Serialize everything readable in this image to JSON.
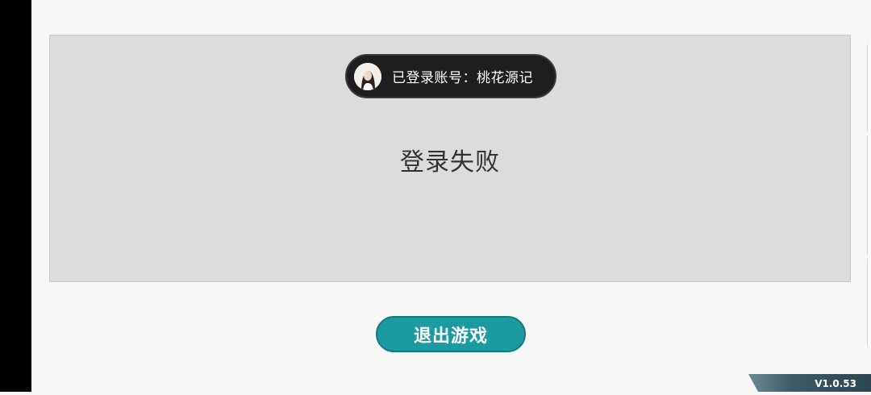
{
  "account": {
    "label": "已登录账号：桃花源记",
    "avatar_icon": "user-avatar"
  },
  "status": {
    "title": "登录失败"
  },
  "actions": {
    "exit_label": "退出游戏"
  },
  "footer": {
    "version": "V1.0.53"
  },
  "colors": {
    "background": "#f7f7f7",
    "panel": "#dcdcdc",
    "pill": "#1e1e1e",
    "exit_button": "#1b9aa0",
    "version_tab": "#3f5b66"
  }
}
